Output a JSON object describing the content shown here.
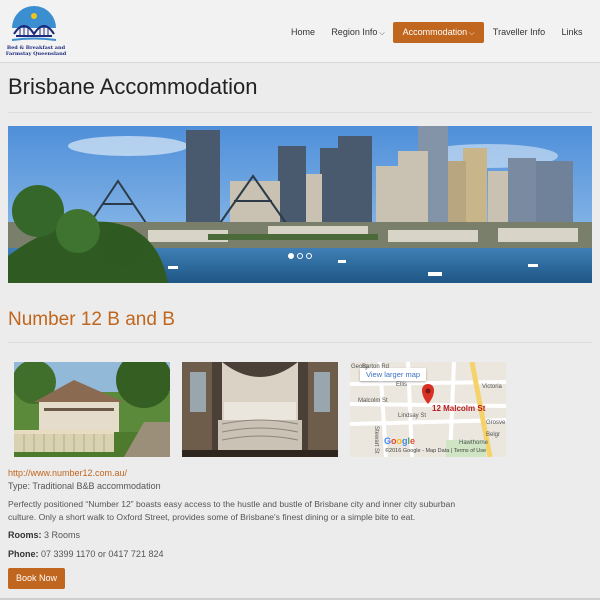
{
  "logo": {
    "line1": "Bed & Breakfast and",
    "line2": "Farmstay Queensland",
    "icon": "bridge-logo"
  },
  "nav": {
    "home": "Home",
    "region": "Region Info",
    "accommodation": "Accommodation",
    "traveller": "Traveller Info",
    "links": "Links",
    "active_color": "#c0661e"
  },
  "page": {
    "title": "Brisbane Accommodation"
  },
  "carousel": {
    "slides": 3,
    "active": 1,
    "image": "brisbane-skyline-story-bridge"
  },
  "listing": {
    "title": "Number 12 B and B",
    "url": "http://www.number12.com.au/",
    "type": "Type: Traditional B&B accommodation",
    "description": "Perfectly positioned “Number 12” boasts easy access to the hustle and bustle of Brisbane city and inner city suburban culture. Only a short walk to Oxford Street, provides some of Brisbane's finest dining or a simple bite to eat.",
    "rooms_label": "Rooms:",
    "rooms_value": "3 Rooms",
    "phone_label": "Phone:",
    "phone_value": "07 3399 1170 or 0417 721 824",
    "book_label": "Book Now"
  },
  "map": {
    "view_larger": "View larger map",
    "address": "12 Malcolm St",
    "streets": [
      "Barton Rd",
      "Ellis",
      "Malcolm St",
      "Lindsay St",
      "Stewart St",
      "Victoria",
      "Grosve",
      "Belgr",
      "Hawthorne"
    ],
    "google": "Google",
    "copyright": "©2016 Google - Map Data",
    "terms": "Terms of Use",
    "corner_label": "Georg"
  },
  "colors": {
    "accent": "#c0661e",
    "background": "#ececec"
  }
}
